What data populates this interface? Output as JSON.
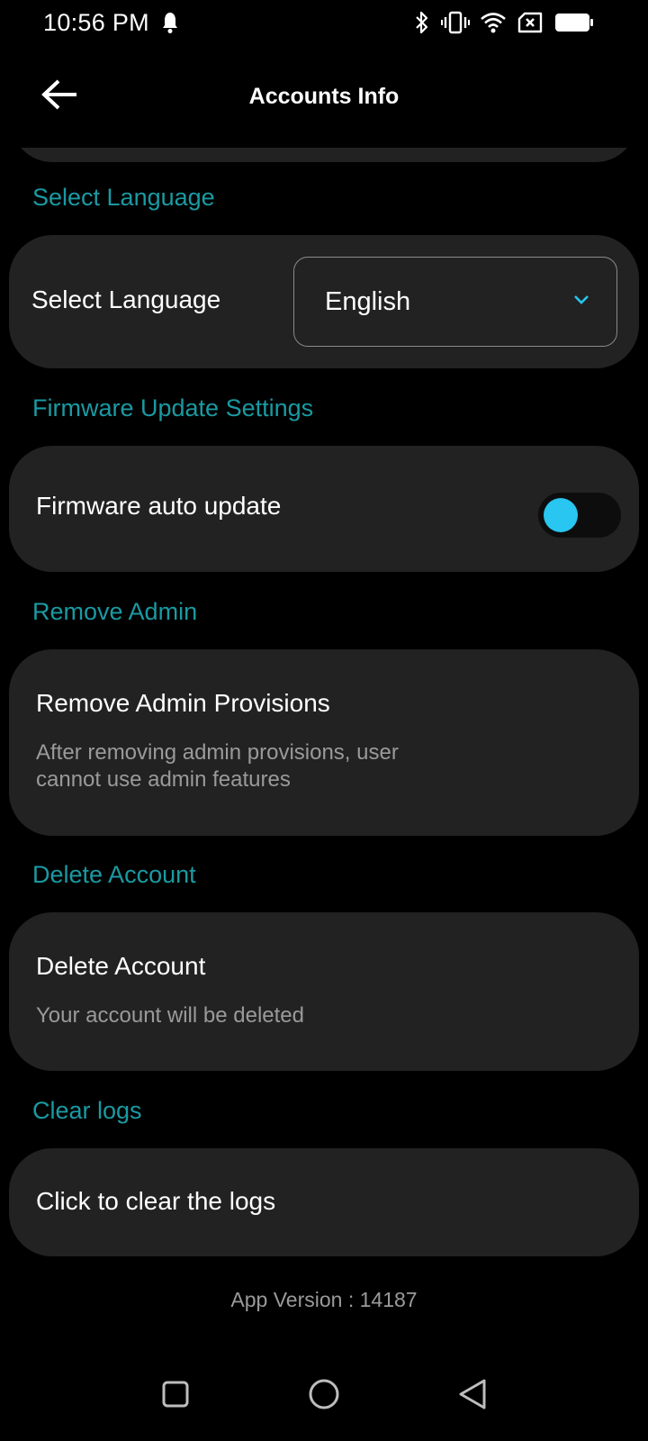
{
  "status_bar": {
    "time": "10:56 PM",
    "icons": [
      "notification-icon",
      "bluetooth-icon",
      "vibrate-icon",
      "wifi-icon",
      "no-sim-icon",
      "battery-icon"
    ]
  },
  "app_bar": {
    "title": "Accounts Info",
    "back_icon": "arrow-left-icon"
  },
  "sections": {
    "language": {
      "header": "Select Language",
      "label": "Select Language",
      "selected": "English"
    },
    "firmware": {
      "header": "Firmware Update Settings",
      "label": "Firmware auto update",
      "toggle_on": false
    },
    "remove_admin": {
      "header": "Remove Admin",
      "title": "Remove Admin Provisions",
      "description": "After removing admin provisions, user cannot use admin features"
    },
    "delete_account": {
      "header": "Delete Account",
      "title": "Delete Account",
      "description": "Your account will be deleted"
    },
    "clear_logs": {
      "header": "Clear logs",
      "title": "Click to clear the logs"
    }
  },
  "footer": {
    "app_version": "App Version : 14187"
  },
  "nav_bar": {
    "icons": [
      "recents-icon",
      "home-icon",
      "back-triangle-icon"
    ]
  },
  "colors": {
    "background": "#000000",
    "card": "#222222",
    "section_header": "#1a9aa2",
    "accent": "#28c6f0",
    "secondary_text": "#9a9a9a"
  }
}
